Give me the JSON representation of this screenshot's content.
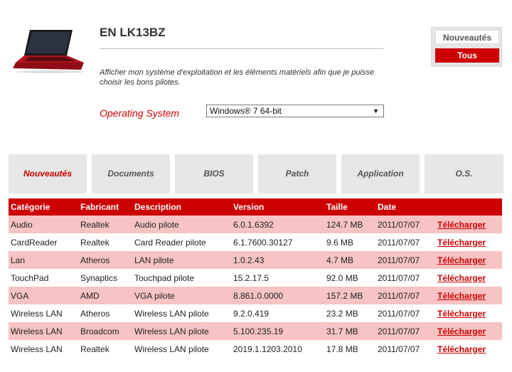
{
  "product": {
    "title": "EN LK13BZ",
    "description": "Afficher mon système d'exploitation et les éléments matériels afin que je puisse choisir les bons pilotes."
  },
  "os": {
    "label": "Operating System",
    "selected": "Windows® 7 64-bit"
  },
  "filter": {
    "new_label": "Nouveautés",
    "all_label": "Tous"
  },
  "tabs": [
    {
      "label": "Nouveautés",
      "active": true
    },
    {
      "label": "Documents"
    },
    {
      "label": "BIOS"
    },
    {
      "label": "Patch"
    },
    {
      "label": "Application"
    },
    {
      "label": "O.S."
    }
  ],
  "table": {
    "headers": [
      "Catégorie",
      "Fabricant",
      "Description",
      "Version",
      "Taille",
      "Date"
    ],
    "rows": [
      {
        "category": "Audio",
        "maker": "Realtek",
        "description": "Audio pilote",
        "version": "6.0.1.6392",
        "size": "124.7 MB",
        "date": "2011/07/07",
        "link": "Télécharger"
      },
      {
        "category": "CardReader",
        "maker": "Realtek",
        "description": "Card Reader pilote",
        "version": "6.1.7600.30127",
        "size": "9.6 MB",
        "date": "2011/07/07",
        "link": "Télécharger"
      },
      {
        "category": "Lan",
        "maker": "Atheros",
        "description": "LAN pilote",
        "version": "1.0.2.43",
        "size": "4.7 MB",
        "date": "2011/07/07",
        "link": "Télécharger"
      },
      {
        "category": "TouchPad",
        "maker": "Synaptics",
        "description": "Touchpad pilote",
        "version": "15.2.17.5",
        "size": "92.0 MB",
        "date": "2011/07/07",
        "link": "Télécharger"
      },
      {
        "category": "VGA",
        "maker": "AMD",
        "description": "VGA pilote",
        "version": "8.861.0.0000",
        "size": "157.2 MB",
        "date": "2011/07/07",
        "link": "Télécharger"
      },
      {
        "category": "Wireless LAN",
        "maker": "Atheros",
        "description": "Wireless LAN pilote",
        "version": "9.2.0.419",
        "size": "23.2 MB",
        "date": "2011/07/07",
        "link": "Télécharger"
      },
      {
        "category": "Wireless LAN",
        "maker": "Broadcom",
        "description": "Wireless LAN pilote",
        "version": "5.100.235.19",
        "size": "31.7 MB",
        "date": "2011/07/07",
        "link": "Télécharger"
      },
      {
        "category": "Wireless LAN",
        "maker": "Realtek",
        "description": "Wireless LAN pilote",
        "version": "2019.1.1203.2010",
        "size": "17.8 MB",
        "date": "2011/07/07",
        "link": "Télécharger"
      }
    ]
  },
  "colors": {
    "accent": "#cc0000",
    "row_tint": "#f7c3c3",
    "tab_bg": "#e6e6e6"
  }
}
